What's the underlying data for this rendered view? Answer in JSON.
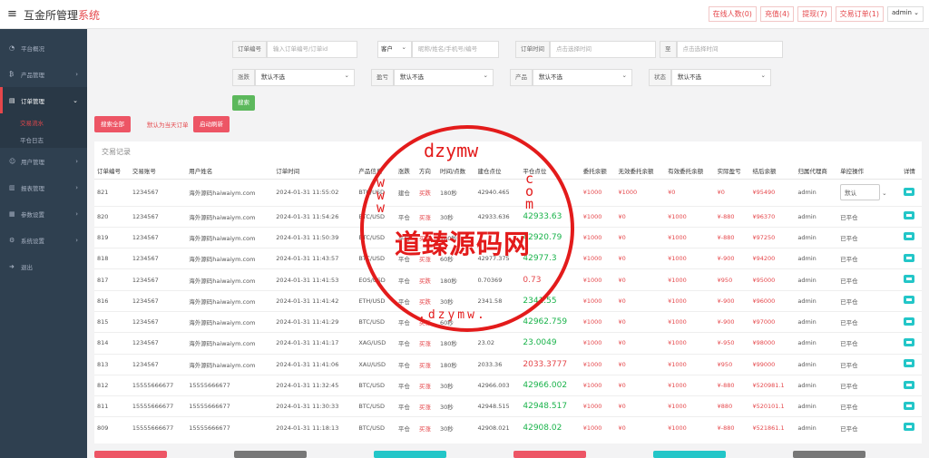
{
  "app": {
    "title_main": "互金所管理",
    "title_accent": "系统"
  },
  "topnav": {
    "online": "在线人数(0)",
    "recharge": "充值(4)",
    "withdraw": "提现(7)",
    "trade_orders": "交易订单(1)",
    "user": "admin"
  },
  "sidebar": {
    "items": [
      {
        "label": "平台概况",
        "icon": "speedometer-icon"
      },
      {
        "label": "产品管理",
        "icon": "bitcoin-icon"
      },
      {
        "label": "订单管理",
        "icon": "document-icon"
      },
      {
        "label": "用户管理",
        "icon": "users-icon"
      },
      {
        "label": "报表管理",
        "icon": "report-icon"
      },
      {
        "label": "参数设置",
        "icon": "sliders-icon"
      },
      {
        "label": "系统设置",
        "icon": "gears-icon"
      },
      {
        "label": "退出",
        "icon": "logout-icon"
      }
    ],
    "subitems": [
      "交易流水",
      "平仓日志"
    ]
  },
  "filters": {
    "order_no_label": "订单编号",
    "order_no_placeholder": "输入订单编号/订单id",
    "customer_type": "客户",
    "nickname_placeholder": "昵称/姓名/手机号/编号",
    "order_time_label": "订单时间",
    "time_placeholder": "点击选择时间",
    "to_label": "至",
    "rise_fall_label": "涨跌",
    "profit_label": "盈亏",
    "product_label": "产品",
    "status_label": "状态",
    "default_select": "默认不选",
    "search_button": "搜索",
    "search_all": "搜索全部",
    "today_note": "默认为当天订单",
    "auto_refresh": "启动刷新"
  },
  "panel": {
    "title": "交易记录"
  },
  "table": {
    "headers": [
      "订单编号",
      "交易账号",
      "用户姓名",
      "订单时间",
      "产品信息",
      "涨跌",
      "方向",
      "时间/点数",
      "建仓点位",
      "平仓点位",
      "委托余额",
      "无效委托余额",
      "有效委托余额",
      "实际盈亏",
      "结后余额",
      "归属代理商",
      "单控操作",
      "详情"
    ],
    "rows": [
      [
        "821",
        "1234567",
        "海外源码haiwaiym.com",
        "2024-01-31 11:55:02",
        "BTC/USD",
        "建仓",
        "买跌",
        "180秒",
        "42940.465",
        "",
        "¥1000",
        "¥1000",
        "¥0",
        "¥0",
        "¥95490",
        "admin",
        "默认",
        ""
      ],
      [
        "820",
        "1234567",
        "海外源码haiwaiym.com",
        "2024-01-31 11:54:26",
        "BTC/USD",
        "平仓",
        "买涨",
        "30秒",
        "42933.636",
        "42933.63",
        "¥1000",
        "¥0",
        "¥1000",
        "¥-880",
        "¥96370",
        "admin",
        "已平仓",
        ""
      ],
      [
        "819",
        "1234567",
        "海外源码haiwaiym.com",
        "2024-01-31 11:50:39",
        "BTC/USD",
        "平仓",
        "买跌",
        "180秒",
        "",
        "42920.79",
        "¥1000",
        "¥0",
        "¥1000",
        "¥-880",
        "¥97250",
        "admin",
        "已平仓",
        ""
      ],
      [
        "818",
        "1234567",
        "海外源码haiwaiym.com",
        "2024-01-31 11:43:57",
        "BTC/USD",
        "平仓",
        "买涨",
        "60秒",
        "42977.375",
        "42977.3",
        "¥1000",
        "¥0",
        "¥1000",
        "¥-900",
        "¥94200",
        "admin",
        "已平仓",
        ""
      ],
      [
        "817",
        "1234567",
        "海外源码haiwaiym.com",
        "2024-01-31 11:41:53",
        "EOS/USD",
        "平仓",
        "买跌",
        "180秒",
        "0.70369",
        "0.73",
        "¥1000",
        "¥0",
        "¥1000",
        "¥950",
        "¥95000",
        "admin",
        "已平仓",
        ""
      ],
      [
        "816",
        "1234567",
        "海外源码haiwaiym.com",
        "2024-01-31 11:41:42",
        "ETH/USD",
        "平仓",
        "买跌",
        "30秒",
        "2341.58",
        "2341.55",
        "¥1000",
        "¥0",
        "¥1000",
        "¥-900",
        "¥96000",
        "admin",
        "已平仓",
        ""
      ],
      [
        "815",
        "1234567",
        "海外源码haiwaiym.com",
        "2024-01-31 11:41:29",
        "BTC/USD",
        "平仓",
        "买涨",
        "60秒",
        "",
        "42962.759",
        "¥1000",
        "¥0",
        "¥1000",
        "¥-900",
        "¥97000",
        "admin",
        "已平仓",
        ""
      ],
      [
        "814",
        "1234567",
        "海外源码haiwaiym.com",
        "2024-01-31 11:41:17",
        "XAG/USD",
        "平仓",
        "买涨",
        "180秒",
        "23.02",
        "23.0049",
        "¥1000",
        "¥0",
        "¥1000",
        "¥-950",
        "¥98000",
        "admin",
        "已平仓",
        ""
      ],
      [
        "813",
        "1234567",
        "海外源码haiwaiym.com",
        "2024-01-31 11:41:06",
        "XAU/USD",
        "平仓",
        "买涨",
        "180秒",
        "2033.36",
        "2033.3777",
        "¥1000",
        "¥0",
        "¥1000",
        "¥950",
        "¥99000",
        "admin",
        "已平仓",
        ""
      ],
      [
        "812",
        "15555666677",
        "15555666677",
        "2024-01-31 11:32:45",
        "BTC/USD",
        "平仓",
        "买涨",
        "30秒",
        "42966.003",
        "42966.002",
        "¥1000",
        "¥0",
        "¥1000",
        "¥-880",
        "¥520981.1",
        "admin",
        "已平仓",
        ""
      ],
      [
        "811",
        "15555666677",
        "15555666677",
        "2024-01-31 11:30:33",
        "BTC/USD",
        "平仓",
        "买涨",
        "30秒",
        "42948.515",
        "42948.517",
        "¥1000",
        "¥0",
        "¥1000",
        "¥880",
        "¥520101.1",
        "admin",
        "已平仓",
        ""
      ],
      [
        "809",
        "15555666677",
        "15555666677",
        "2024-01-31 11:18:13",
        "BTC/USD",
        "平仓",
        "买涨",
        "30秒",
        "42908.021",
        "42908.02",
        "¥1000",
        "¥0",
        "¥1000",
        "¥-880",
        "¥521861.1",
        "admin",
        "已平仓",
        ""
      ]
    ]
  },
  "watermark": {
    "top": "dzymw",
    "center": "道臻源码网",
    "side_left": "www",
    "side_right": "com",
    "bottom": ".dzymw."
  },
  "colors": {
    "accent": "#e5474b",
    "sidebar": "#2f4050",
    "green": "#1ab34b",
    "cyan": "#23c6c8"
  }
}
